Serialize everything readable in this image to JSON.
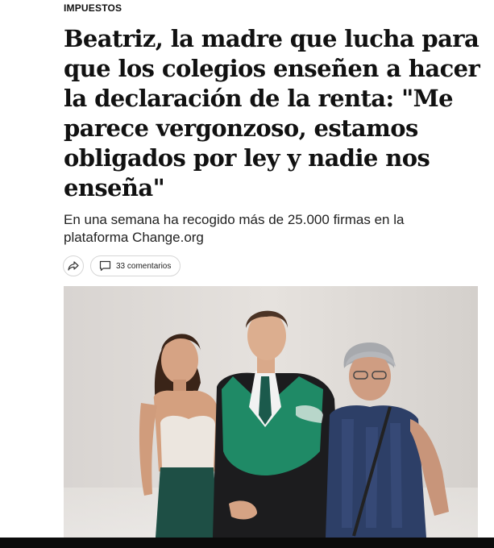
{
  "article": {
    "section": "IMPUESTOS",
    "headline": "Beatriz, la madre que lucha para que los colegios enseñen a hacer la declaración de la renta: \"Me parece vergonzoso, estamos obligados por ley y nadie nos enseña\"",
    "subtitle": "En una semana ha recogido más de 25.000 firmas en la plataforma Change.org"
  },
  "actions": {
    "share_icon": "share-arrow-icon",
    "comments_icon": "comment-bubble-icon",
    "comments_label": "33 comentarios"
  },
  "photo": {
    "description_icon": "article-photo"
  },
  "colors": {
    "text": "#111111",
    "border": "#d6d6d6",
    "gown_green": "#1f8a66",
    "bottom_bar": "#0b0b0b"
  }
}
